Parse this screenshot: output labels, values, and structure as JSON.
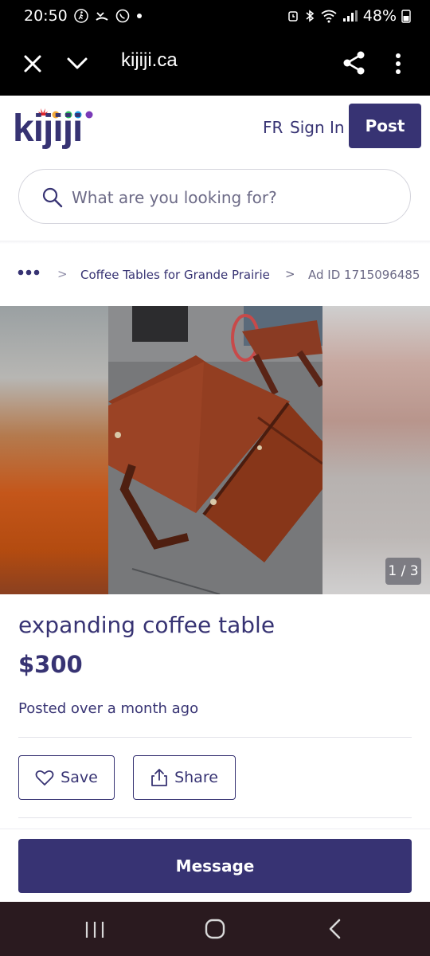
{
  "status_bar": {
    "time": "20:50",
    "battery": "48%"
  },
  "browser": {
    "url": "kijiji.ca"
  },
  "header": {
    "logo_text": "kijiji",
    "fr_label": "FR",
    "signin_label": "Sign In",
    "post_label": "Post"
  },
  "search": {
    "placeholder": "What are you looking for?"
  },
  "breadcrumb": {
    "more": "•••",
    "separator": ">",
    "category": "Coffee Tables for Grande Prairie",
    "ad_id": "Ad ID 1715096485"
  },
  "gallery": {
    "counter": "1 / 3"
  },
  "listing": {
    "title": "expanding coffee table",
    "price": "$300",
    "posted": "Posted over a month ago"
  },
  "actions": {
    "save_label": "Save",
    "share_label": "Share"
  },
  "message": {
    "label": "Message"
  },
  "colors": {
    "brand": "#373373",
    "logo_leaf": "#e0262d",
    "logo_dot_green": "#2dbf5f",
    "logo_dot_blue": "#1ba0e6",
    "logo_dot_purple": "#7a3ab8"
  },
  "icons": [
    "walk-icon",
    "missed-call-icon",
    "whatsapp-icon",
    "alarm-icon",
    "bluetooth-icon",
    "wifi-icon",
    "signal-icon",
    "battery-icon",
    "close-icon",
    "chevron-down-icon",
    "share-icon",
    "more-vert-icon",
    "search-icon",
    "heart-icon",
    "upload-share-icon",
    "recents-icon",
    "home-icon",
    "back-icon"
  ]
}
